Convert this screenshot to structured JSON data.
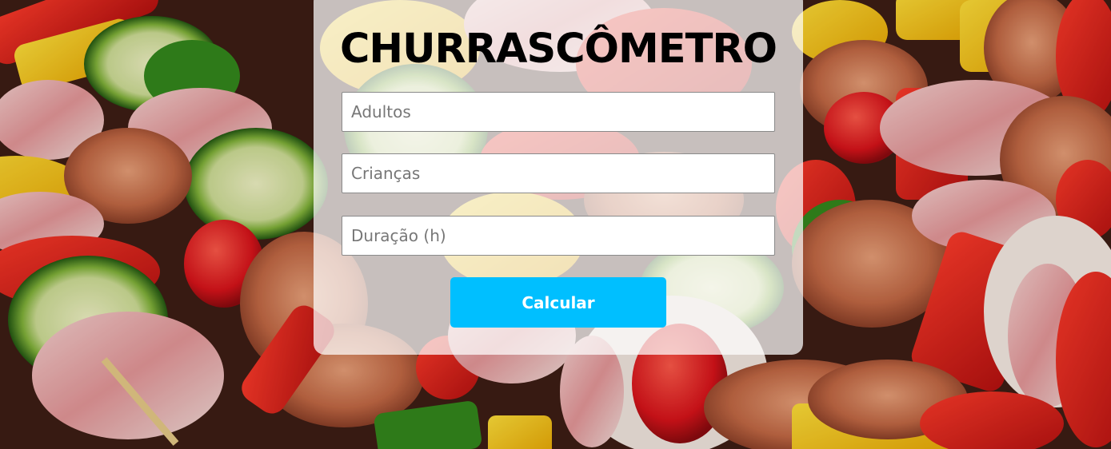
{
  "app": {
    "title": "CHURRASCÔMETRO"
  },
  "form": {
    "adults_placeholder": "Adultos",
    "children_placeholder": "Crianças",
    "duration_placeholder": "Duração (h)",
    "adults_value": "",
    "children_value": "",
    "duration_value": "",
    "submit_label": "Calcular"
  },
  "colors": {
    "button_bg": "#00bfff",
    "button_text": "#ffffff",
    "title": "#000000",
    "card_bg": "rgba(255,255,255,0.72)"
  }
}
